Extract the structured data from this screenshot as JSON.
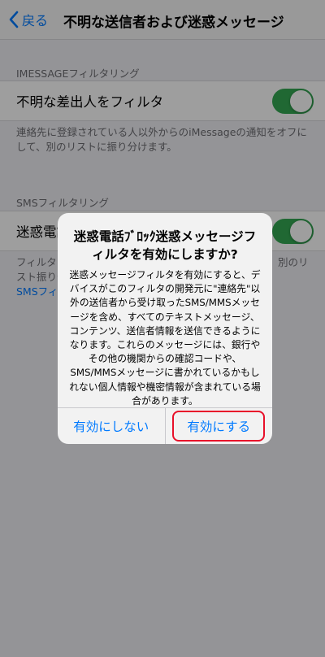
{
  "nav": {
    "back_label": "戻る",
    "title": "不明な送信者および迷惑メッセージ"
  },
  "imessage_section": {
    "header": "IMESSAGEフィルタリング",
    "cell_label": "不明な差出人をフィルタ",
    "toggle_on": true,
    "footer": "連絡先に登録されている人以外からのiMessageの通知をオフにして、別のリストに振り分けます。"
  },
  "sms_section": {
    "header": "SMSフィルタリング",
    "cell_label": "迷惑電話",
    "toggle_on": true,
    "footer_left_1": "フィルタ",
    "footer_right_1": "別のリ",
    "footer_left_2": "スト振り分",
    "footer_link": "SMSフィ"
  },
  "alert": {
    "title": "迷惑電話ﾌﾞﾛｯｸ迷惑メッセージフィルタを有効にしますか?",
    "message": "迷惑メッセージフィルタを有効にすると、デバイスがこのフィルタの開発元に\"連絡先\"以外の送信者から受け取ったSMS/MMSメッセージを含め、すべてのテキストメッセージ、コンテンツ、送信者情報を送信できるようになります。これらのメッセージには、銀行やその他の機関からの確認コードや、SMS/MMSメッセージに書かれているかもしれない個人情報や機密情報が含まれている場合があります。",
    "cancel_label": "有効にしない",
    "confirm_label": "有効にする"
  },
  "colors": {
    "accent": "#007aff",
    "toggle_on": "#34a853",
    "highlight": "#e8102a"
  }
}
